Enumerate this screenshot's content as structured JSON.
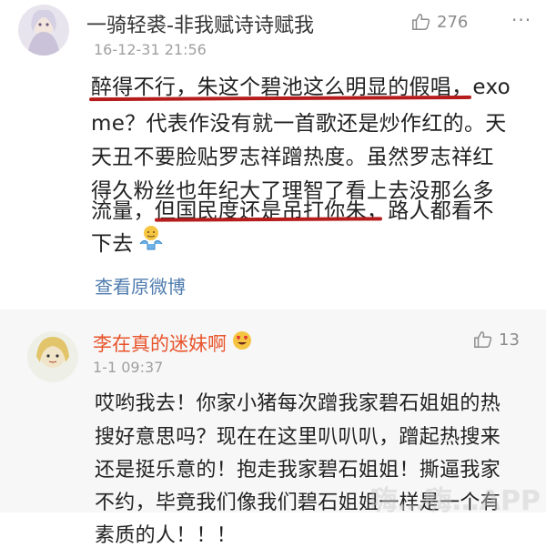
{
  "comment1": {
    "username": "一骑轻裘-非我赋诗诗赋我",
    "timestamp": "16-12-31 21:56",
    "likes": "276",
    "more_icon": "ellipsis-icon",
    "lines": [
      "醉得不行，朱这个碧池这么明显的假唱，exo",
      "me？代表作没有就一首歌还是炒作红的。天",
      "天丑不要脸贴罗志祥蹭热度。虽然罗志祥红",
      "得久粉丝也年纪大了理智了看上去没那么多",
      "流量，但国民度还是吊打你朱，路人都看不",
      "下去"
    ],
    "emoji": "shrug-emoji-icon",
    "view_original": "查看原微博"
  },
  "comment2": {
    "username": "李在真的迷妹啊",
    "username_emoji": "heart-eyes-emoji-icon",
    "timestamp": "1-1 09:37",
    "likes": "13",
    "lines": [
      "哎哟我去！你家小猪每次蹭我家碧石姐姐的热",
      "搜好意思吗？现在在这里叭叭叭，蹭起热搜来",
      "还是挺乐意的！抱走我家碧石姐姐！撕逼我家",
      "不约，毕竟我们像我们碧石姐姐一样是一个有",
      "素质的人！！！"
    ]
  },
  "watermark": "嗨…嗨…APP",
  "colors": {
    "username2": "#e8542b",
    "link": "#4f7cae",
    "underline": "#b71c1c"
  }
}
